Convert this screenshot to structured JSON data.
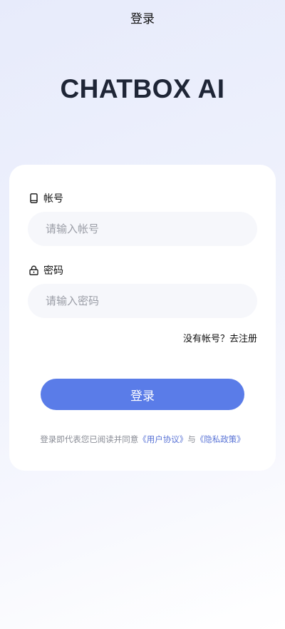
{
  "header": {
    "title": "登录"
  },
  "brand": {
    "name": "CHATBOX AI"
  },
  "form": {
    "account": {
      "label": "帐号",
      "icon": "phone-icon",
      "placeholder": "请输入帐号",
      "value": ""
    },
    "password": {
      "label": "密码",
      "icon": "lock-icon",
      "placeholder": "请输入密码",
      "value": ""
    },
    "register": {
      "prompt": "没有帐号？",
      "link": "去注册"
    },
    "submit_label": "登录"
  },
  "agreement": {
    "prefix": "登录即代表您已阅读并同意",
    "user_agreement": "《用户协议》",
    "conjunction": "与",
    "privacy_policy": "《隐私政策》"
  },
  "colors": {
    "accent": "#5a7ce8",
    "link": "#5a74d6",
    "brand_text": "#1e2536"
  }
}
